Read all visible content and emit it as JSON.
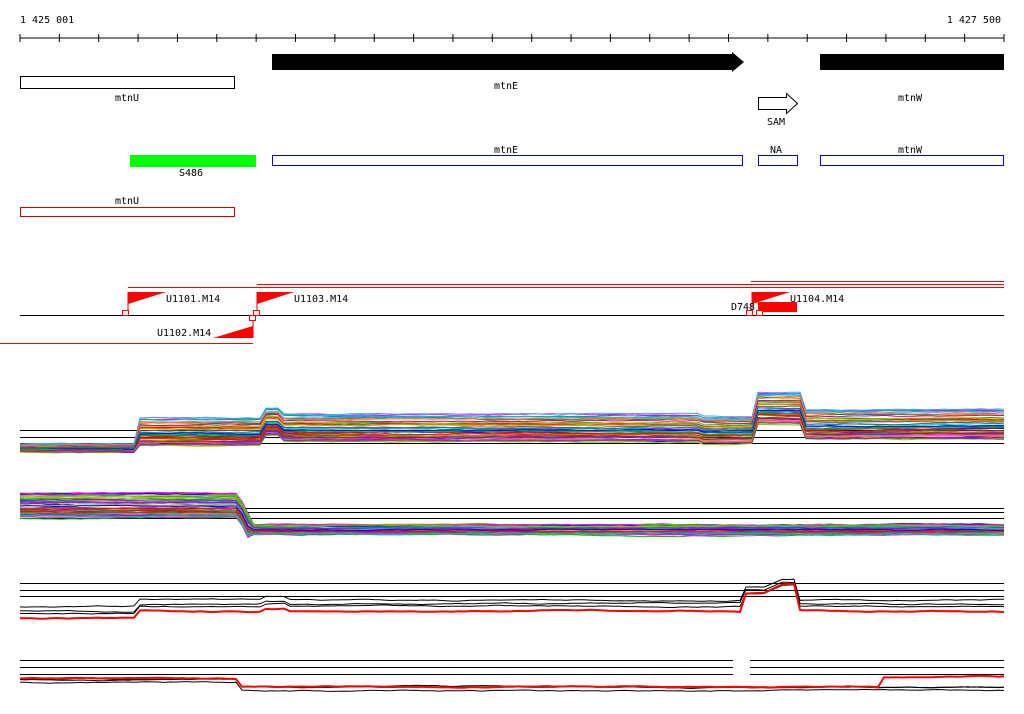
{
  "ruler": {
    "start_label": "1 425 001",
    "end_label": "1 427 500"
  },
  "annotation_track": {
    "genes": [
      {
        "name": "mtnU",
        "label": "mtnU",
        "strand": "open"
      },
      {
        "name": "mtnE",
        "label": "mtnE",
        "strand": "forward"
      },
      {
        "name": "SAM",
        "label": "SAM",
        "strand": "forward-outline"
      },
      {
        "name": "mtnW",
        "label": "mtnW",
        "strand": "forward"
      }
    ]
  },
  "feature_track": {
    "items": [
      {
        "name": "S486",
        "label": "S486",
        "color": "#00ff00"
      },
      {
        "name": "mtnE",
        "label": "mtnE",
        "color": "#0000cc"
      },
      {
        "name": "NA",
        "label": "NA",
        "color": "#0000cc"
      },
      {
        "name": "mtnW",
        "label": "mtnW",
        "color": "#0000cc"
      }
    ]
  },
  "red_gene_track": {
    "label": "mtnU",
    "color": "#cc0000"
  },
  "transcript_track": {
    "units": [
      {
        "name": "U1101",
        "label": "U1101.M14"
      },
      {
        "name": "U1102",
        "label": "U1102.M14"
      },
      {
        "name": "U1103",
        "label": "U1103.M14"
      },
      {
        "name": "U1104",
        "label": "U1104.M14"
      },
      {
        "name": "D748",
        "label": "D748"
      }
    ],
    "accent_color": "#ff0000"
  },
  "expression_tracks": {
    "palette": [
      "#ff0000",
      "#00c000",
      "#0000ff",
      "#ff00ff",
      "#00c0c0",
      "#c0c000",
      "#ff8000",
      "#8000ff",
      "#008080",
      "#804000",
      "#ff6080",
      "#40a0ff",
      "#80c000",
      "#c000c0",
      "#606060"
    ],
    "line_color": "#000000",
    "highlight_color": "#ff0000"
  }
}
